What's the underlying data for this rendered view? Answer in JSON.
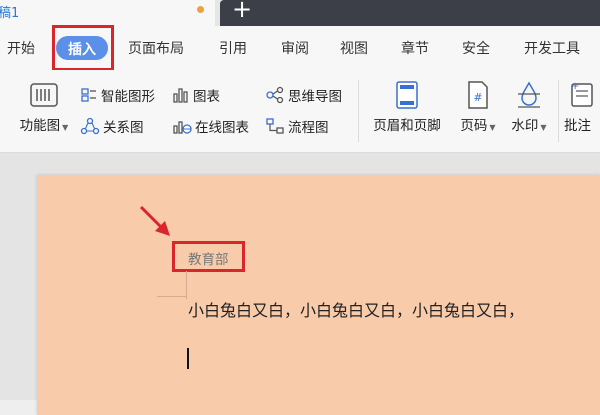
{
  "window": {
    "doc_tab_title": "稿1",
    "new_tab_symbol": "+"
  },
  "menu": {
    "tabs": [
      "开始",
      "插入",
      "页面布局",
      "引用",
      "审阅",
      "视图",
      "章节",
      "安全",
      "开发工具"
    ],
    "active": "插入"
  },
  "ribbon": {
    "func_chart": "功能图",
    "smart_shape": "智能图形",
    "chart": "图表",
    "mind_map": "思维导图",
    "relation_chart": "关系图",
    "online_chart": "在线图表",
    "flow_chart": "流程图",
    "header_footer": "页眉和页脚",
    "page_number": "页码",
    "watermark": "水印",
    "annotation": "批注"
  },
  "document": {
    "header_text": "教育部",
    "body_text": "小白兔白又白，小白兔白又白，小白兔白又白，"
  },
  "colors": {
    "accent_blue": "#5b8fe8",
    "highlight_red": "#d9262c",
    "page_background": "#f8cbaa",
    "titlebar_dark": "#3c3f48"
  }
}
